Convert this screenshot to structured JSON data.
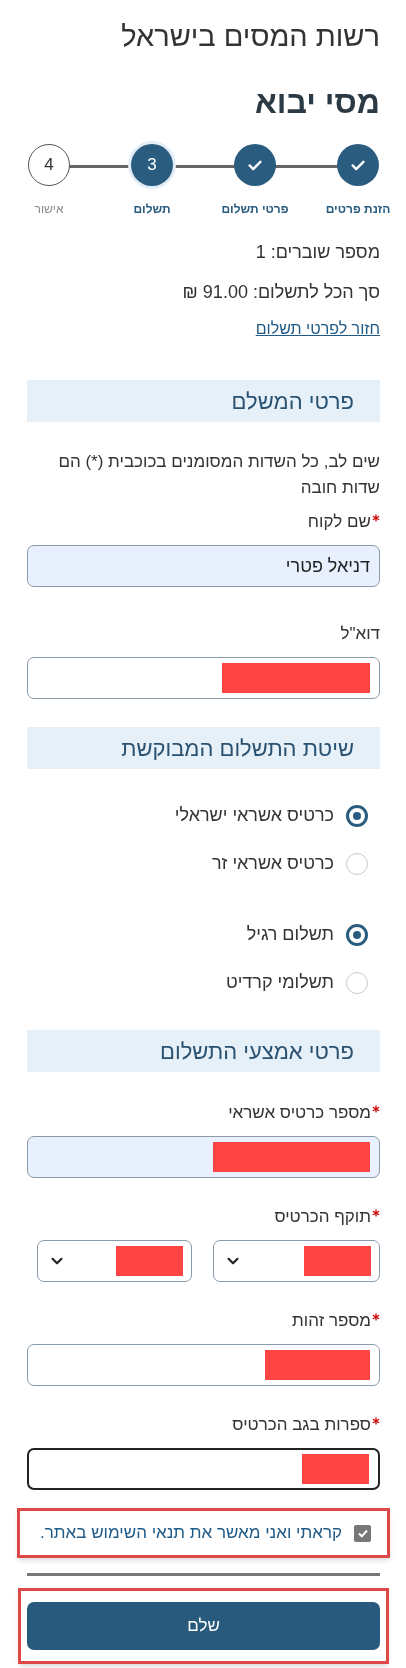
{
  "header": {
    "title": "רשות המסים בישראל",
    "page_title": "מסי יבוא"
  },
  "steps": [
    {
      "label": "הזנת פרטים",
      "completed": true,
      "selected": false
    },
    {
      "label": "פרטי תשלום",
      "completed": true,
      "selected": false
    },
    {
      "label": "תשלום",
      "completed": false,
      "selected": true,
      "number": "3"
    },
    {
      "label": "אישור",
      "completed": false,
      "selected": false,
      "number": "4"
    }
  ],
  "summary": {
    "vouchers": "מספר שוברים: 1",
    "total": "סך הכל לתשלום: 91.00 ₪",
    "back_link": "חזור לפרטי תשלום"
  },
  "payer_section": {
    "heading": "פרטי המשלם",
    "notice": "שים לב, כל השדות המסומנים בכוכבית (*) הם שדות חובה",
    "fields": [
      {
        "label": "שם לקוח",
        "required": true,
        "value": "דניאל פטרי",
        "filled": true
      },
      {
        "label": "דוא\"ל",
        "required": false,
        "redacted": true,
        "filled": false
      }
    ]
  },
  "method_section": {
    "heading": "שיטת התשלום המבוקשת",
    "card_type": [
      {
        "label": "כרטיס אשראי ישראלי",
        "selected": true
      },
      {
        "label": "כרטיס אשראי זר",
        "selected": false
      }
    ],
    "payment_type": [
      {
        "label": "תשלום רגיל",
        "selected": true
      },
      {
        "label": "תשלומי קרדיט",
        "selected": false
      }
    ]
  },
  "card_section": {
    "heading": "פרטי אמצעי התשלום",
    "card_number": {
      "label": "מספר כרטיס אשראי",
      "required": true,
      "redacted": true,
      "filled": true
    },
    "expiry": {
      "label": "תוקף הכרטיס",
      "required": true,
      "selects": [
        {
          "redacted": true
        },
        {
          "redacted": true
        }
      ]
    },
    "id_number": {
      "label": "מספר זהות",
      "required": true,
      "redacted": true,
      "filled": false
    },
    "cvv": {
      "label": "ספרות בגב הכרטיס",
      "required": true,
      "redacted": true,
      "filled": false,
      "focused": true
    }
  },
  "terms": {
    "label": "קראתי ואני מאשר את תנאי השימוש באתר.",
    "checked": true,
    "highlighted": true
  },
  "pay_button": {
    "label": "שלם",
    "highlighted": true
  }
}
